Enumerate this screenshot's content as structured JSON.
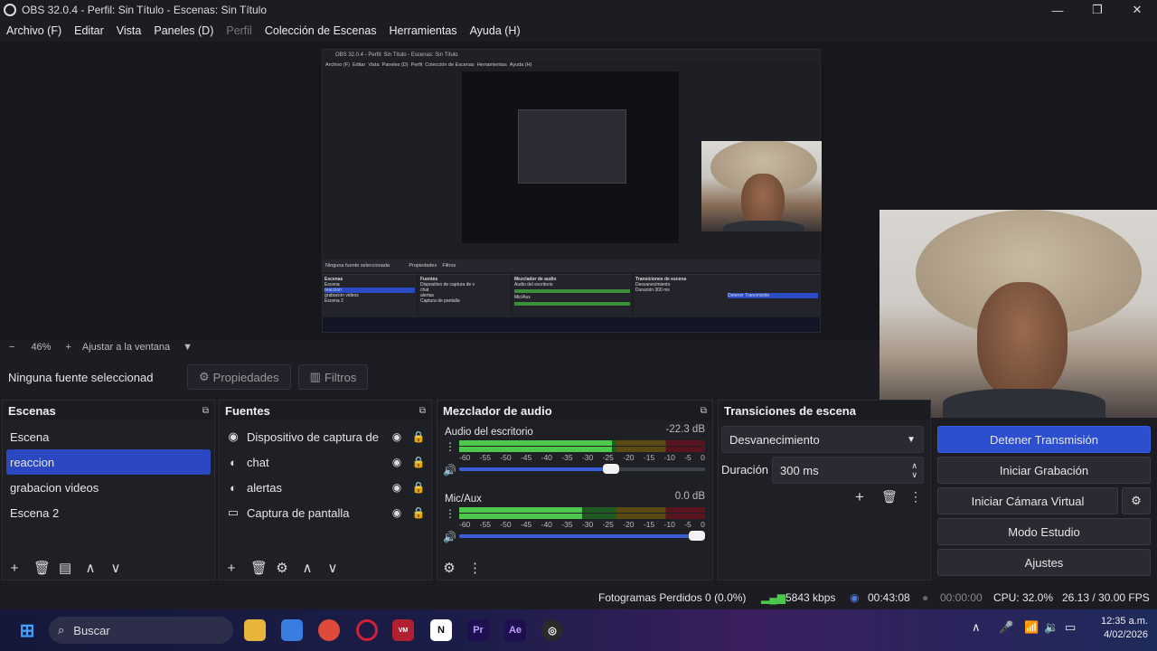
{
  "window": {
    "title": "OBS 32.0.4 - Perfil: Sin Título - Escenas: Sin Título",
    "minimize": "—",
    "maximize": "❐",
    "close": "✕"
  },
  "menu": [
    "Archivo (F)",
    "Editar",
    "Vista",
    "Paneles (D)",
    "Perfil",
    "Colección de Escenas",
    "Herramientas",
    "Ayuda (H)"
  ],
  "zoom": {
    "minus": "−",
    "value": "46%",
    "plus": "+",
    "fit_label": "Ajustar a la ventana"
  },
  "source_bar": {
    "none_selected": "Ninguna fuente seleccionad",
    "properties": "Propiedades",
    "filters": "Filtros"
  },
  "scenes": {
    "title": "Escenas",
    "items": [
      "Escena",
      "reaccion",
      "grabacion videos",
      "Escena 2"
    ],
    "selected_index": 1
  },
  "sources": {
    "title": "Fuentes",
    "items": [
      {
        "name": "Dispositivo de captura de v",
        "icon": "camera-icon"
      },
      {
        "name": "chat",
        "icon": "browser-icon"
      },
      {
        "name": "alertas",
        "icon": "browser-icon"
      },
      {
        "name": "Captura de pantalla",
        "icon": "monitor-icon"
      }
    ]
  },
  "mixer": {
    "title": "Mezclador de audio",
    "ticks": [
      "-60",
      "-55",
      "-50",
      "-45",
      "-40",
      "-35",
      "-30",
      "-25",
      "-20",
      "-15",
      "-10",
      "-5",
      "0"
    ],
    "channels": [
      {
        "name": "Audio del escritorio",
        "db": "-22.3 dB",
        "level": 0.62,
        "volume": 0.65
      },
      {
        "name": "Mic/Aux",
        "db": "0.0 dB",
        "level": 0.5,
        "volume": 1.0
      }
    ]
  },
  "transitions": {
    "title": "Transiciones de escena",
    "type": "Desvanecimiento",
    "duration_label": "Duración",
    "duration": "300 ms"
  },
  "controls": {
    "stop_stream": "Detener Transmisión",
    "start_record": "Iniciar Grabación",
    "virtual_cam": "Iniciar Cámara Virtual",
    "studio": "Modo Estudio",
    "settings": "Ajustes"
  },
  "status": {
    "dropped": "Fotogramas Perdidos 0 (0.0%)",
    "bitrate": "5843 kbps",
    "stream_time": "00:43:08",
    "rec_time": "00:00:00",
    "cpu": "CPU: 32.0%",
    "fps": "26.13 / 30.00 FPS"
  },
  "taskbar": {
    "search": "Buscar",
    "time": "12:35 a.m.",
    "date": "4/02/2026"
  },
  "colors": {
    "accent": "#2c4fd0",
    "selected": "#2b48c0",
    "meter_green": "#4cc94c"
  }
}
